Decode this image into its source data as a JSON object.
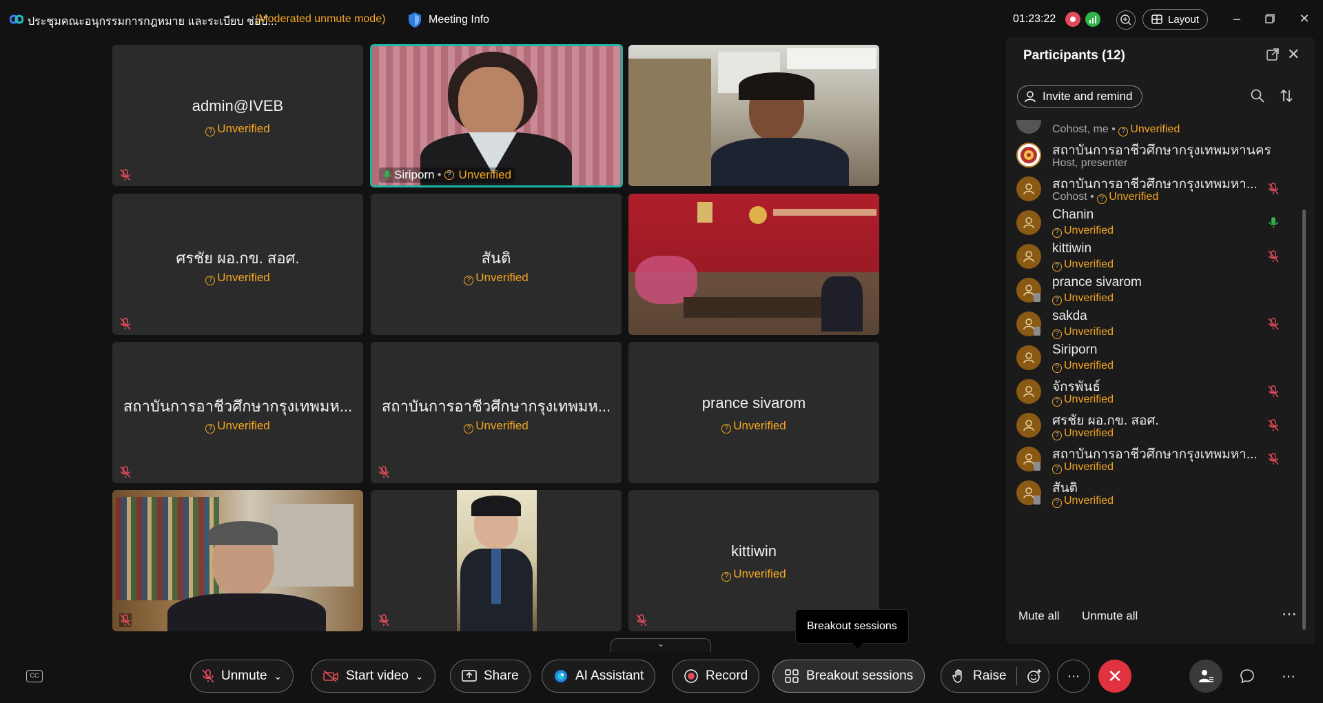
{
  "window": {
    "meeting_title": "ประชุมคณะอนุกรรมการกฎหมาย และระเบียบ ช่อบั...",
    "mode": "(Moderated unmute mode)",
    "meeting_info_label": "Meeting Info",
    "timer": "01:23:22",
    "layout_label": "Layout"
  },
  "grid": {
    "tiles": [
      {
        "name": "admin@IVEB",
        "status": "Unverified"
      },
      {
        "name": "Siriporn",
        "status": "Unverified"
      },
      {
        "name": "",
        "status": ""
      },
      {
        "name": "ศรชัย ผอ.กข. สอศ.",
        "status": "Unverified"
      },
      {
        "name": "สันติ",
        "status": "Unverified"
      },
      {
        "name": "",
        "status": ""
      },
      {
        "name": "สถาบันการอาชีวศึกษากรุงเทพมห...",
        "status": "Unverified"
      },
      {
        "name": "สถาบันการอาชีวศึกษากรุงเทพมห...",
        "status": "Unverified"
      },
      {
        "name": "prance sivarom",
        "status": "Unverified"
      },
      {
        "name": "",
        "status": ""
      },
      {
        "name": "",
        "status": ""
      },
      {
        "name": "kittiwin",
        "status": "Unverified"
      }
    ]
  },
  "panel": {
    "title": "Participants (12)",
    "invite_label": "Invite and remind",
    "mute_all": "Mute all",
    "unmute_all": "Unmute all",
    "participants": [
      {
        "name": "",
        "role": "Cohost, me",
        "status": "Unverified"
      },
      {
        "name": "สถาบันการอาชีวศึกษากรุงเทพมหานคร",
        "role": "Host, presenter",
        "status": ""
      },
      {
        "name": "สถาบันการอาชีวศึกษากรุงเทพมหา...",
        "role": "Cohost",
        "status": "Unverified"
      },
      {
        "name": "Chanin",
        "role": "",
        "status": "Unverified"
      },
      {
        "name": "kittiwin",
        "role": "",
        "status": "Unverified"
      },
      {
        "name": "prance sivarom",
        "role": "",
        "status": "Unverified"
      },
      {
        "name": "sakda",
        "role": "",
        "status": "Unverified"
      },
      {
        "name": "Siriporn",
        "role": "",
        "status": "Unverified"
      },
      {
        "name": "จักรพันธ์",
        "role": "",
        "status": "Unverified"
      },
      {
        "name": "ศรชัย ผอ.กข. สอศ.",
        "role": "",
        "status": "Unverified"
      },
      {
        "name": "สถาบันการอาชีวศึกษากรุงเทพมหา...",
        "role": "",
        "status": "Unverified"
      },
      {
        "name": "สันติ",
        "role": "",
        "status": "Unverified"
      }
    ]
  },
  "toolbar": {
    "unmute": "Unmute",
    "start_video": "Start video",
    "share": "Share",
    "ai_assistant": "AI Assistant",
    "record": "Record",
    "breakout": "Breakout sessions",
    "raise": "Raise",
    "tooltip": "Breakout sessions"
  },
  "colors": {
    "accent_unverified": "#f5a623",
    "active_speaker": "#1fb5a5",
    "end_call": "#e0323f",
    "mic_muted": "#e24b5b"
  }
}
